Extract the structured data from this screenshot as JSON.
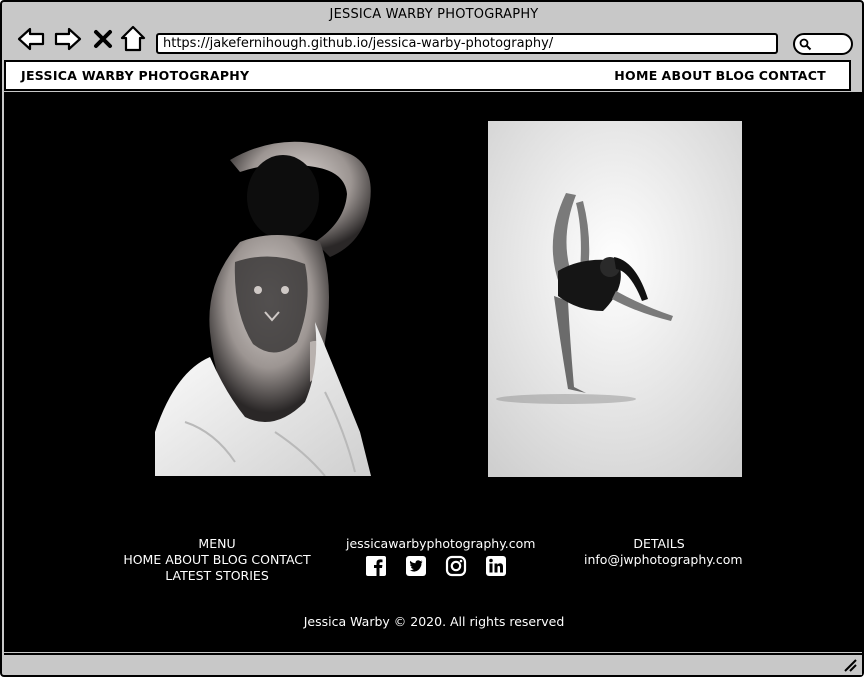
{
  "window": {
    "title": "JESSICA WARBY PHOTOGRAPHY"
  },
  "browser": {
    "url": "https://jakefernihough.github.io/jessica-warby-photography/",
    "icons": [
      "back-arrow-icon",
      "forward-arrow-icon",
      "close-x-icon",
      "home-icon",
      "search-icon"
    ]
  },
  "site_nav": {
    "logo": "JESSICA WARBY PHOTOGRAPHY",
    "links": [
      "HOME",
      "ABOUT",
      "BLOG",
      "CONTACT"
    ]
  },
  "gallery": {
    "images": [
      "photo-tattooed-back-with-white-sheet",
      "photo-dancer-high-kick"
    ]
  },
  "footer": {
    "menu": {
      "heading": "MENU",
      "links": [
        "HOME",
        "ABOUT",
        "BLOG",
        "CONTACT"
      ],
      "latest": "LATEST STORIES"
    },
    "social": {
      "site": "jessicawarbyphotography.com",
      "icons": [
        "facebook-icon",
        "twitter-icon",
        "instagram-icon",
        "linkedin-icon"
      ]
    },
    "details": {
      "heading": "DETAILS",
      "email": "info@jwphotography.com"
    },
    "copyright": "Jessica Warby © 2020. All rights reserved"
  },
  "colors": {
    "chrome": "#c8c8c8",
    "page_bg": "#000000",
    "text_light": "#ffffff"
  }
}
